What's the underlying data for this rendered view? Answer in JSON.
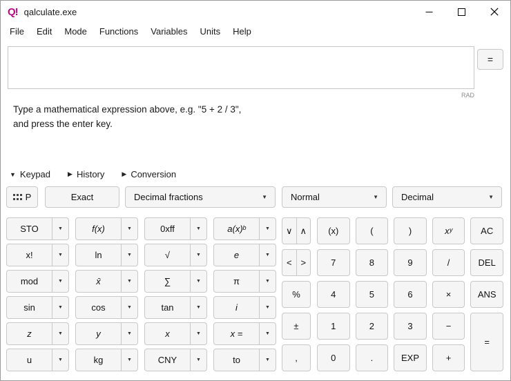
{
  "window": {
    "logo": "Q!",
    "logo_color": "#b50a85",
    "title": "qalculate.exe"
  },
  "menu": {
    "items": [
      "File",
      "Edit",
      "Mode",
      "Functions",
      "Variables",
      "Units",
      "Help"
    ]
  },
  "expression": {
    "value": "",
    "equals_button": "=",
    "angle_mode": "RAD"
  },
  "hint": {
    "line1": "Type a mathematical expression above, e.g. \"5 + 2 / 3\",",
    "line2": "and press the enter key."
  },
  "expanders": [
    {
      "arrow": "▼",
      "label": "Keypad"
    },
    {
      "arrow": "▶",
      "label": "History"
    },
    {
      "arrow": "▶",
      "label": "Conversion"
    }
  ],
  "toolbar": {
    "keypad_toggle_label": "P",
    "exact_label": "Exact",
    "fraction_dropdown": "Decimal fractions",
    "display_dropdown": "Normal",
    "base_dropdown": "Decimal"
  },
  "icons": {
    "dropdown": "▼"
  },
  "keypad": {
    "left": [
      {
        "l": "STO",
        "n": "sto"
      },
      {
        "l": "f(x)",
        "n": "function",
        "i": 1
      },
      {
        "l": "0xff",
        "n": "hex"
      },
      {
        "l": "a(x)ᵇ",
        "n": "a-x-power-b",
        "i": 1
      },
      {
        "l": "x!",
        "n": "factorial"
      },
      {
        "l": "ln",
        "n": "ln"
      },
      {
        "l": "√",
        "n": "sqrt"
      },
      {
        "l": "e",
        "n": "e",
        "i": 1
      },
      {
        "l": "mod",
        "n": "mod"
      },
      {
        "l": "x̄",
        "n": "x-bar",
        "i": 1
      },
      {
        "l": "∑",
        "n": "sum"
      },
      {
        "l": "π",
        "n": "pi"
      },
      {
        "l": "sin",
        "n": "sin"
      },
      {
        "l": "cos",
        "n": "cos"
      },
      {
        "l": "tan",
        "n": "tan"
      },
      {
        "l": "i",
        "n": "imaginary",
        "i": 1
      },
      {
        "l": "z",
        "n": "z",
        "i": 1
      },
      {
        "l": "y",
        "n": "y",
        "i": 1
      },
      {
        "l": "x",
        "n": "x",
        "i": 1
      },
      {
        "l": "x =",
        "n": "x-equals",
        "i": 1
      },
      {
        "l": "u",
        "n": "unit-u"
      },
      {
        "l": "kg",
        "n": "kg"
      },
      {
        "l": "CNY",
        "n": "cny"
      },
      {
        "l": "to",
        "n": "to"
      }
    ],
    "middle": [
      {
        "pair": [
          {
            "l": "∨",
            "n": "down"
          },
          {
            "l": "∧",
            "n": "up"
          }
        ]
      },
      {
        "pair": [
          {
            "l": "<",
            "n": "left"
          },
          {
            "l": ">",
            "n": "right"
          }
        ]
      },
      {
        "l": "%",
        "n": "percent"
      },
      {
        "l": "±",
        "n": "plus-minus"
      },
      {
        "l": ",",
        "n": "comma"
      }
    ],
    "numpad": [
      {
        "l": "(x)",
        "n": "smart-parens"
      },
      {
        "l": "(",
        "n": "open-paren"
      },
      {
        "l": ")",
        "n": "close-paren"
      },
      {
        "l": "xʸ",
        "n": "x-power-y",
        "i": 1
      },
      {
        "l": "AC",
        "n": "all-clear"
      },
      {
        "l": "7",
        "n": "7"
      },
      {
        "l": "8",
        "n": "8"
      },
      {
        "l": "9",
        "n": "9"
      },
      {
        "l": "/",
        "n": "divide"
      },
      {
        "l": "DEL",
        "n": "delete"
      },
      {
        "l": "4",
        "n": "4"
      },
      {
        "l": "5",
        "n": "5"
      },
      {
        "l": "6",
        "n": "6"
      },
      {
        "l": "×",
        "n": "multiply"
      },
      {
        "l": "ANS",
        "n": "answer"
      },
      {
        "l": "1",
        "n": "1"
      },
      {
        "l": "2",
        "n": "2"
      },
      {
        "l": "3",
        "n": "3"
      },
      {
        "l": "−",
        "n": "minus"
      },
      {
        "l": "=",
        "n": "equals",
        "tall": 1
      },
      {
        "l": "0",
        "n": "0"
      },
      {
        "l": ".",
        "n": "decimal-point"
      },
      {
        "l": "EXP",
        "n": "exponent"
      },
      {
        "l": "+",
        "n": "plus"
      }
    ]
  }
}
